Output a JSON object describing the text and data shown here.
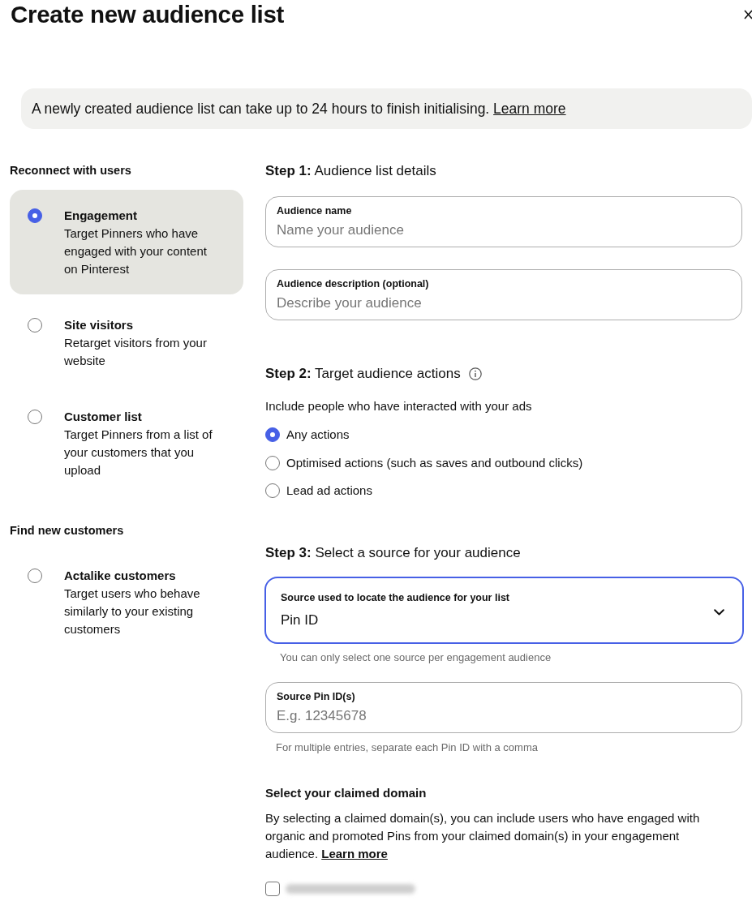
{
  "dialog": {
    "title": "Create new audience list"
  },
  "notice": {
    "text": "A newly created audience list can take up to 24 hours to finish initialising.",
    "link": "Learn more"
  },
  "audience_groups": [
    {
      "heading": "Reconnect with users",
      "options": [
        {
          "title": "Engagement",
          "description": "Target Pinners who have engaged with your content on Pinterest",
          "selected": true
        },
        {
          "title": "Site visitors",
          "description": "Retarget visitors from your website",
          "selected": false
        },
        {
          "title": "Customer list",
          "description": "Target Pinners from a list of your customers that you upload",
          "selected": false
        }
      ]
    },
    {
      "heading": "Find new customers",
      "options": [
        {
          "title": "Actalike customers",
          "description": "Target users who behave similarly to your existing customers",
          "selected": false
        }
      ]
    }
  ],
  "step_1": {
    "heading": "**Step 1:** Audience list details",
    "fields": [
      {
        "label": "Audience name",
        "placeholder": "Name your audience"
      },
      {
        "label": "Audience description (optional)",
        "placeholder": "Describe your audience"
      }
    ]
  },
  "step_2": {
    "heading": "**Step 2:** Target audience actions",
    "prompt": "Include people who have interacted with your ads",
    "options": [
      {
        "label": "Any actions",
        "selected": true
      },
      {
        "label": "Optimised actions (such as saves and outbound clicks)",
        "selected": false
      },
      {
        "label": "Lead ad actions",
        "selected": false
      }
    ]
  },
  "step_3": {
    "heading": "**Step 3:** Select a source for your audience",
    "source_select": {
      "label": "Source used to locate the audience for your list",
      "value": "Pin ID",
      "focused": true,
      "helper": "You can only select one source per engagement audience"
    },
    "pin_field": {
      "label": "Source Pin ID(s)",
      "placeholder": "E.g. 12345678",
      "helper": "For multiple entries, separate each Pin ID with a comma"
    }
  },
  "claimed_domain": {
    "heading": "Select your claimed domain",
    "text": "By selecting a claimed domain(s), you can include users who have engaged with organic and promoted Pins from your claimed domain(s) in your engagement audience.",
    "link": "Learn more",
    "domains": [
      {
        "checked": false
      }
    ]
  }
}
